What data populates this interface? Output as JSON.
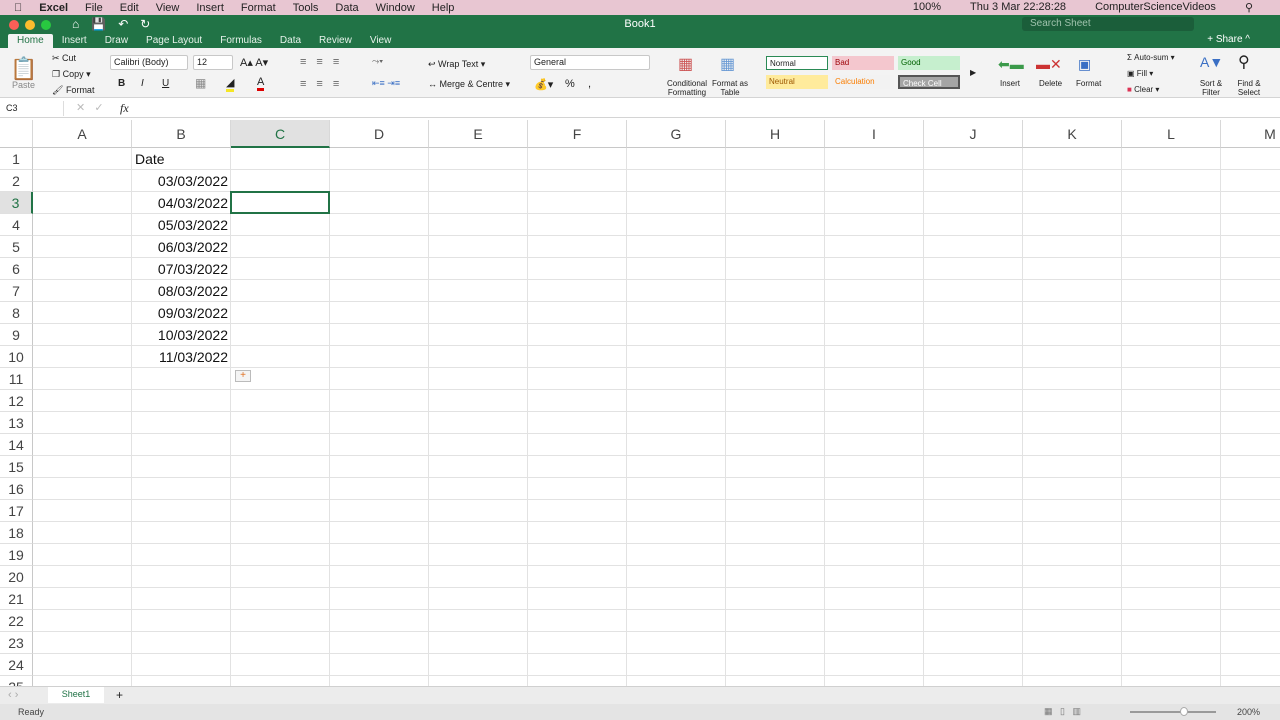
{
  "menubar": {
    "app": "Excel",
    "items": [
      "File",
      "Edit",
      "View",
      "Insert",
      "Format",
      "Tools",
      "Data",
      "Window",
      "Help"
    ],
    "battery": "100%",
    "clock": "Thu 3 Mar  22:28:28",
    "user": "ComputerScienceVideos"
  },
  "window": {
    "title": "Book1",
    "search_placeholder": "Search Sheet",
    "share": "Share"
  },
  "tabs": [
    "Home",
    "Insert",
    "Draw",
    "Page Layout",
    "Formulas",
    "Data",
    "Review",
    "View"
  ],
  "ribbon": {
    "paste": "Paste",
    "cut": "Cut",
    "copy": "Copy",
    "format_painter": "Format",
    "font": "Calibri (Body)",
    "size": "12",
    "bold": "B",
    "italic": "I",
    "underline": "U",
    "wrap": "Wrap Text",
    "merge": "Merge & Centre",
    "number_format": "General",
    "percent": "%",
    "cond_fmt": "Conditional Formatting",
    "fmt_table": "Format as Table",
    "styles": [
      {
        "label": "Normal",
        "bg": "#ffffff",
        "fg": "#222222"
      },
      {
        "label": "Bad",
        "bg": "#f4c7ce",
        "fg": "#9c0006"
      },
      {
        "label": "Good",
        "bg": "#c6efce",
        "fg": "#006100"
      },
      {
        "label": "Neutral",
        "bg": "#ffeb9c",
        "fg": "#9c5700"
      },
      {
        "label": "Calculation",
        "bg": "#f2f2f2",
        "fg": "#fa7d00"
      },
      {
        "label": "Check Cell",
        "bg": "#a5a5a5",
        "fg": "#ffffff"
      }
    ],
    "insert": "Insert",
    "delete": "Delete",
    "format": "Format",
    "autosum": "Auto-sum",
    "fill": "Fill",
    "clear": "Clear",
    "sort": "Sort & Filter",
    "find": "Find & Select"
  },
  "formula_bar": {
    "name_box": "C3",
    "fx": "fx",
    "value": ""
  },
  "grid": {
    "columns": [
      "A",
      "B",
      "C",
      "D",
      "E",
      "F",
      "G",
      "H",
      "I",
      "J",
      "K",
      "L",
      "M"
    ],
    "selected_col": "C",
    "selected_row": 3,
    "row_count": 25,
    "cells": {
      "B1": "Date",
      "B2": "03/03/2022",
      "B3": "04/03/2022",
      "B4": "05/03/2022",
      "B5": "06/03/2022",
      "B6": "07/03/2022",
      "B7": "08/03/2022",
      "B8": "09/03/2022",
      "B9": "10/03/2022",
      "B10": "11/03/2022"
    }
  },
  "sheets": [
    "Sheet1"
  ],
  "status": {
    "text": "Ready",
    "zoom": "200%"
  },
  "colors": {
    "accent": "#217346"
  }
}
